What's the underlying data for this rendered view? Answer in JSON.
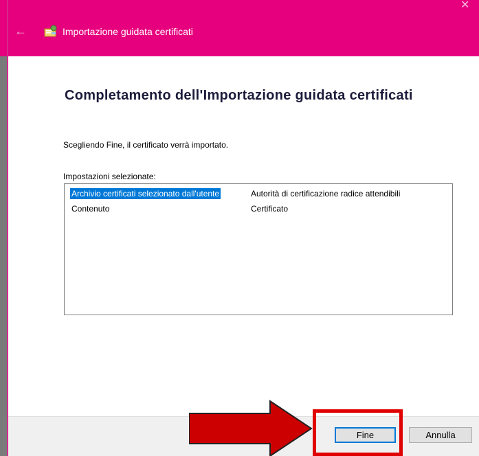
{
  "window": {
    "title": "Importazione guidata certificati",
    "back_icon": "back-arrow-icon",
    "close_icon": "close-icon",
    "accent_color": "#e6007e"
  },
  "main": {
    "heading": "Completamento dell'Importazione guidata certificati",
    "description": "Scegliendo Fine, il certificato verrà importato.",
    "settings_label": "Impostazioni selezionate:",
    "settings": [
      {
        "name": "Archivio certificati selezionato dall'utente",
        "value": "Autorità di certificazione radice attendibili",
        "selected": true
      },
      {
        "name": "Contenuto",
        "value": "Certificato",
        "selected": false
      }
    ]
  },
  "footer": {
    "finish_label": "Fine",
    "cancel_label": "Annulla"
  },
  "annotation": {
    "arrow_color": "#cc0000",
    "highlight_color": "#e00000"
  }
}
